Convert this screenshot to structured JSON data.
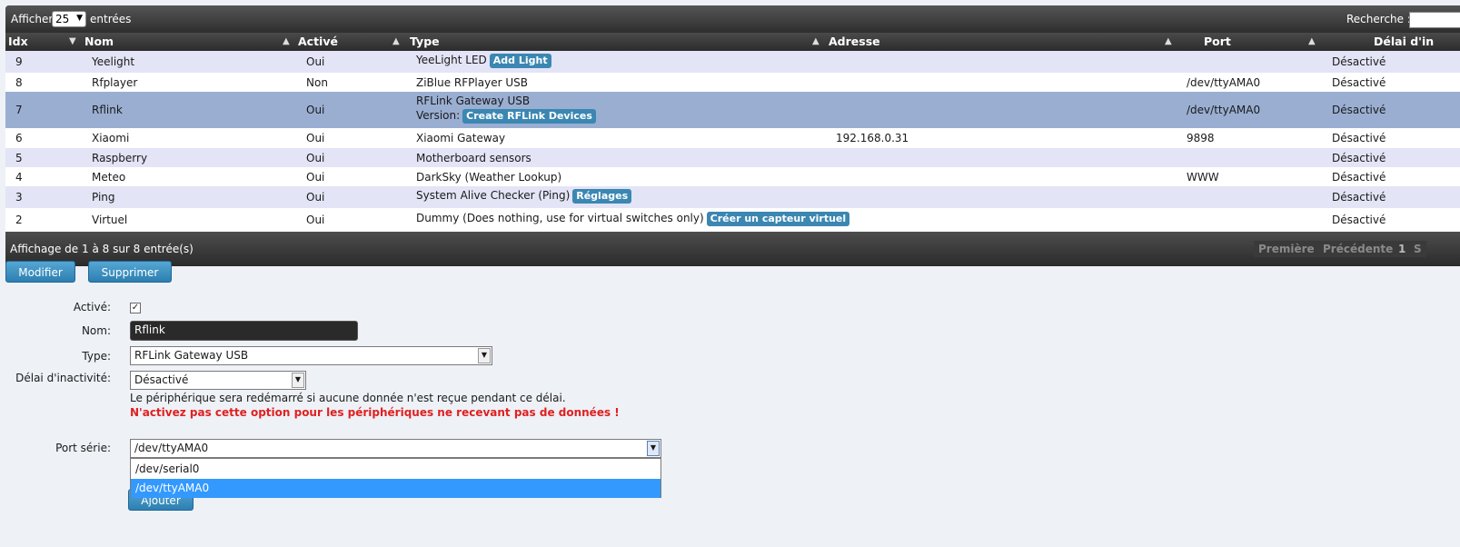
{
  "table_controls": {
    "show_label": "Afficher",
    "entries_label": "entrées",
    "page_length": "25",
    "search_label": "Recherche :"
  },
  "columns": [
    "Idx",
    "Nom",
    "Activé",
    "Type",
    "Adresse",
    "Port",
    "Délai d'in"
  ],
  "rows": [
    {
      "idx": "9",
      "name": "Yeelight",
      "enabled": "Oui",
      "type": "YeeLight LED",
      "type_prefix": "",
      "action": "Add Light",
      "address": "",
      "port": "",
      "timeout": "Désactivé"
    },
    {
      "idx": "8",
      "name": "Rfplayer",
      "enabled": "Non",
      "type": "ZiBlue RFPlayer USB",
      "type_prefix": "",
      "action": "",
      "address": "",
      "port": "/dev/ttyAMA0",
      "timeout": "Désactivé"
    },
    {
      "idx": "7",
      "name": "Rflink",
      "enabled": "Oui",
      "type": "RFLink Gateway USB",
      "type_prefix": "Version:",
      "action": "Create RFLink Devices",
      "address": "",
      "port": "/dev/ttyAMA0",
      "timeout": "Désactivé"
    },
    {
      "idx": "6",
      "name": "Xiaomi",
      "enabled": "Oui",
      "type": "Xiaomi Gateway",
      "type_prefix": "",
      "action": "",
      "address": "192.168.0.31",
      "port": "9898",
      "timeout": "Désactivé"
    },
    {
      "idx": "5",
      "name": "Raspberry",
      "enabled": "Oui",
      "type": "Motherboard sensors",
      "type_prefix": "",
      "action": "",
      "address": "",
      "port": "",
      "timeout": "Désactivé"
    },
    {
      "idx": "4",
      "name": "Meteo",
      "enabled": "Oui",
      "type": "DarkSky (Weather Lookup)",
      "type_prefix": "",
      "action": "",
      "address": "",
      "port": "WWW",
      "timeout": "Désactivé"
    },
    {
      "idx": "3",
      "name": "Ping",
      "enabled": "Oui",
      "type": "System Alive Checker (Ping)",
      "type_prefix": "",
      "action": "Réglages",
      "address": "",
      "port": "",
      "timeout": "Désactivé"
    },
    {
      "idx": "2",
      "name": "Virtuel",
      "enabled": "Oui",
      "type": "Dummy (Does nothing, use for virtual switches only)",
      "type_prefix": "",
      "action": "Créer un capteur virtuel",
      "address": "",
      "port": "",
      "timeout": "Désactivé"
    }
  ],
  "table_footer": {
    "info": "Affichage de 1 à 8 sur 8 entrée(s)",
    "first": "Première",
    "previous": "Précédente",
    "page": "1",
    "next_partial": "S"
  },
  "buttons": {
    "modify": "Modifier",
    "delete": "Supprimer",
    "add": "Ajouter"
  },
  "form": {
    "enabled_label": "Activé:",
    "enabled_checked": true,
    "check_mark": "✓",
    "name_label": "Nom:",
    "name_value": "Rflink",
    "type_label": "Type:",
    "type_value": "RFLink Gateway USB",
    "timeout_label": "Délai d'inactivité:",
    "timeout_value": "Désactivé",
    "timeout_note": "Le périphérique sera redémarré si aucune donnée n'est reçue pendant ce délai.",
    "timeout_warning": "N'activez pas cette option pour les périphériques ne recevant pas de données !",
    "port_label": "Port série:",
    "port_value": "/dev/ttyAMA0",
    "port_options": [
      "/dev/serial0",
      "/dev/ttyAMA0"
    ],
    "port_selected_index": 1
  },
  "colors": {
    "accent": "#3b87b2",
    "selected_row": "#9aaed2",
    "warning": "#e02020"
  }
}
